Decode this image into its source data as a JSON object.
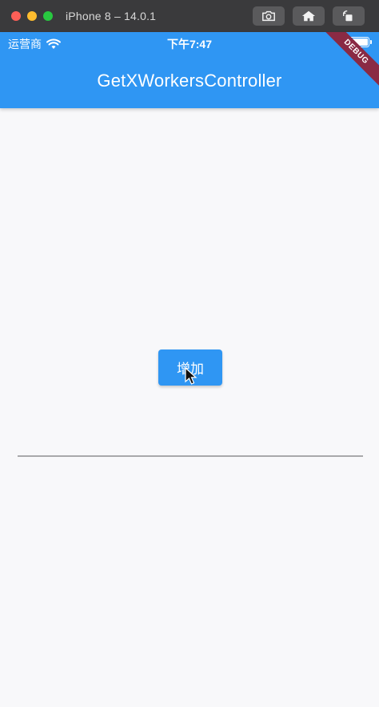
{
  "simulator": {
    "title": "iPhone 8 – 14.0.1",
    "tools": [
      {
        "name": "screenshot-icon"
      },
      {
        "name": "home-icon"
      },
      {
        "name": "rotate-icon"
      }
    ]
  },
  "status_bar": {
    "carrier": "运营商",
    "time": "下午7:47"
  },
  "app_bar": {
    "title": "GetXWorkersController",
    "debug_label": "DEBUG",
    "color": "#2f96f3"
  },
  "body": {
    "add_button_label": "增加"
  }
}
